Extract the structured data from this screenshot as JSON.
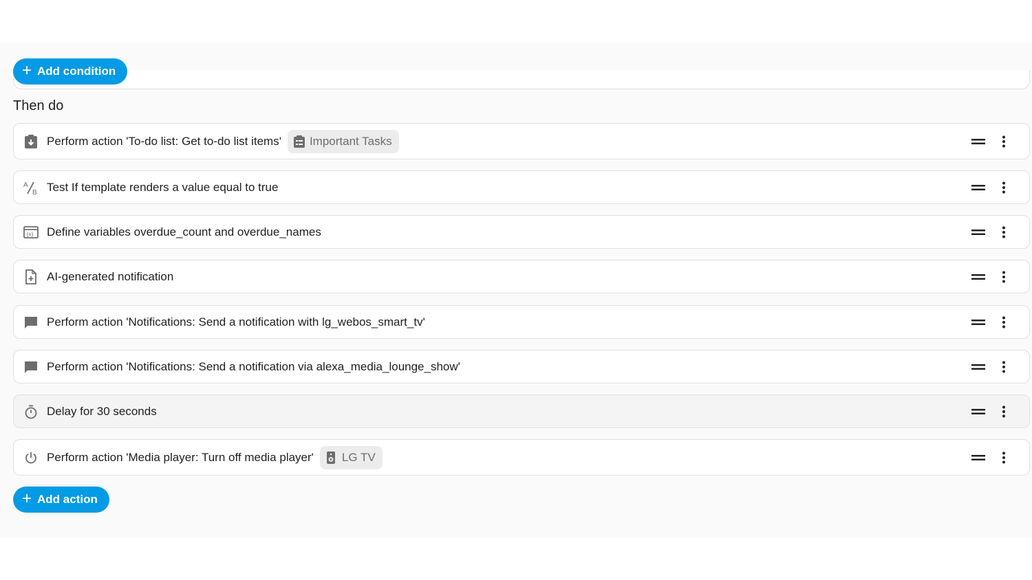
{
  "conditions": {
    "add_label": "Add condition"
  },
  "actions_section": {
    "title": "Then do",
    "add_label": "Add action",
    "items": [
      {
        "icon": "clipboard-arrow-down-icon",
        "label": "Perform action 'To-do list: Get to-do list items'",
        "chip": {
          "icon": "clipboard-list-icon",
          "label": "Important Tasks"
        }
      },
      {
        "icon": "a-b-testing-icon",
        "label": "Test If template renders a value equal to true"
      },
      {
        "icon": "variable-box-icon",
        "label": "Define variables overdue_count and overdue_names"
      },
      {
        "icon": "file-plus-icon",
        "label": "AI-generated notification"
      },
      {
        "icon": "message-icon",
        "label": "Perform action 'Notifications: Send a notification with lg_webos_smart_tv'"
      },
      {
        "icon": "message-icon",
        "label": "Perform action 'Notifications: Send a notification via alexa_media_lounge_show'"
      },
      {
        "icon": "timer-icon",
        "label": "Delay for 30 seconds"
      },
      {
        "icon": "power-icon",
        "label": "Perform action 'Media player: Turn off media player'",
        "chip": {
          "icon": "speaker-icon",
          "label": "LG TV"
        }
      }
    ]
  },
  "colors": {
    "accent": "#039be5",
    "icon": "#6d6d6d",
    "text": "#212121",
    "border": "#e0e0e0"
  }
}
